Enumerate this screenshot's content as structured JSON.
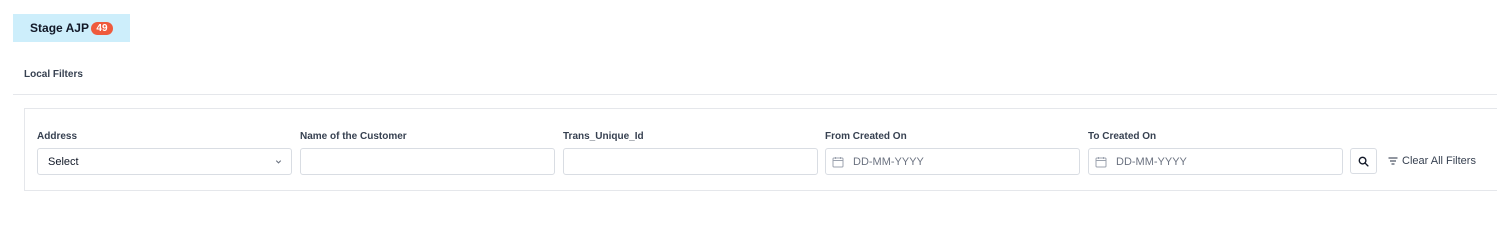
{
  "tab": {
    "label": "Stage AJP",
    "count": "49",
    "badge_color": "#ef5a3c",
    "bg_color": "#cdeefb"
  },
  "section": {
    "title": "Local Filters"
  },
  "filters": {
    "address": {
      "label": "Address",
      "value": "Select"
    },
    "customer_name": {
      "label": "Name of the Customer",
      "value": ""
    },
    "trans_id": {
      "label": "Trans_Unique_Id",
      "value": ""
    },
    "from_created": {
      "label": "From Created On",
      "placeholder": "DD-MM-YYYY",
      "icon": "calendar-icon"
    },
    "to_created": {
      "label": "To Created On",
      "placeholder": "DD-MM-YYYY",
      "icon": "calendar-icon"
    }
  },
  "actions": {
    "search_icon": "search-icon",
    "clear_label": "Clear All Filters",
    "clear_icon": "filter-lines-icon"
  }
}
